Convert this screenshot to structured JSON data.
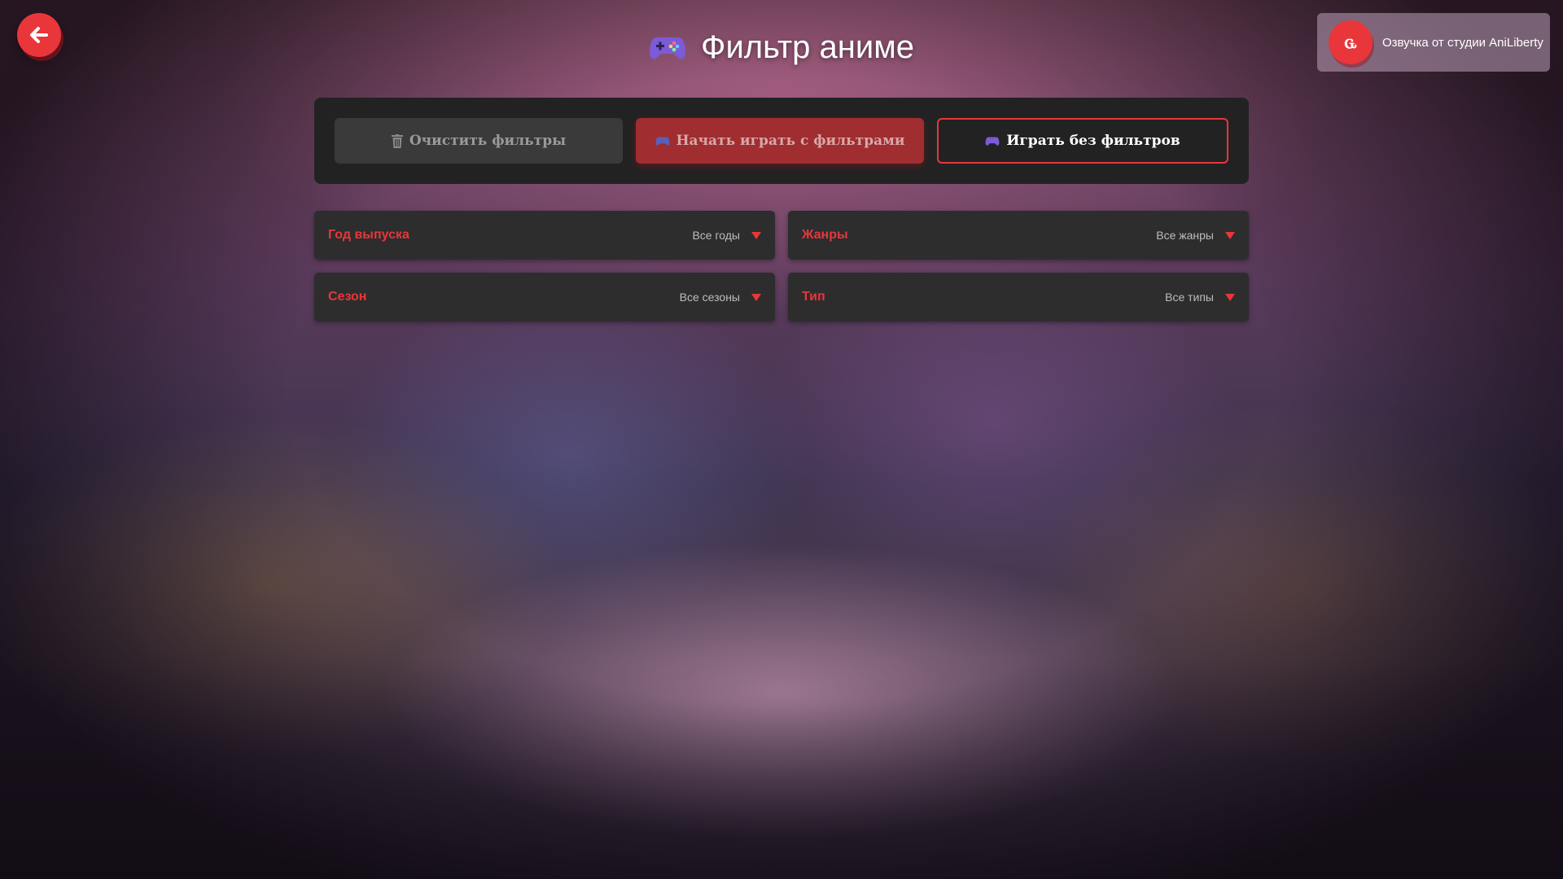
{
  "header": {
    "title": "Фильтр аниме",
    "title_icon": "gamepad-icon",
    "back_icon": "arrow-left-icon"
  },
  "studio": {
    "text": "Озвучка от студии AniLiberty",
    "logo_icon": "aniliberty-logo-icon",
    "logo_glyph": "ꮹ"
  },
  "actions": {
    "clear": {
      "icon": "trash-icon",
      "label": "Очистить фильтры"
    },
    "start": {
      "icon": "gamepad-icon",
      "label": "Начать играть с фильтрами"
    },
    "no_filter": {
      "icon": "gamepad-icon",
      "label": "Играть без фильтров"
    }
  },
  "filters": {
    "year": {
      "label": "Год выпуска",
      "value": "Все годы"
    },
    "genre": {
      "label": "Жанры",
      "value": "Все жанры"
    },
    "season": {
      "label": "Сезон",
      "value": "Все сезоны"
    },
    "type": {
      "label": "Тип",
      "value": "Все типы"
    }
  },
  "colors": {
    "accent": "#e8363b",
    "panel": "#222222",
    "filter_bg": "#2d2d2d"
  }
}
